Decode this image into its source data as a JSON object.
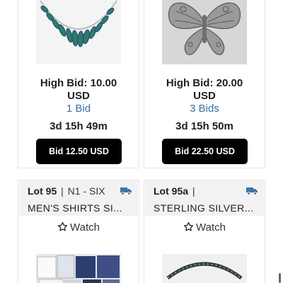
{
  "lots_top": [
    {
      "image_icon": "necklace-image",
      "high_bid_line1": "High Bid: 10.00",
      "high_bid_line2": "USD",
      "bid_count": "1 Bid",
      "time_left": "3d 15h 49m",
      "bid_button": "Bid 12.50 USD"
    },
    {
      "image_icon": "butterfly-brooch-image",
      "high_bid_line1": "High Bid: 20.00",
      "high_bid_line2": "USD",
      "bid_count": "3 Bids",
      "time_left": "3d 15h 50m",
      "bid_button": "Bid 22.50 USD"
    }
  ],
  "lots_bottom": [
    {
      "lot_number": "Lot 95",
      "separator": "|",
      "seller": "N1 - SIX",
      "title": "MEN'S SHIRTS SI...",
      "watch_label": "Watch",
      "shipping_icon": "truck-icon",
      "image_icon": "shirts-image"
    },
    {
      "lot_number": "Lot 95a",
      "separator": "|",
      "seller": "",
      "title": "STERLING SILVER...",
      "watch_label": "Watch",
      "shipping_icon": "truck-icon",
      "image_icon": "headband-image"
    }
  ],
  "colors": {
    "bid_button_bg": "#000000",
    "bid_count_link": "#3b6fa0",
    "shipping_icon": "#3f73a8",
    "lot_header_bg": "#f2f2f2"
  }
}
